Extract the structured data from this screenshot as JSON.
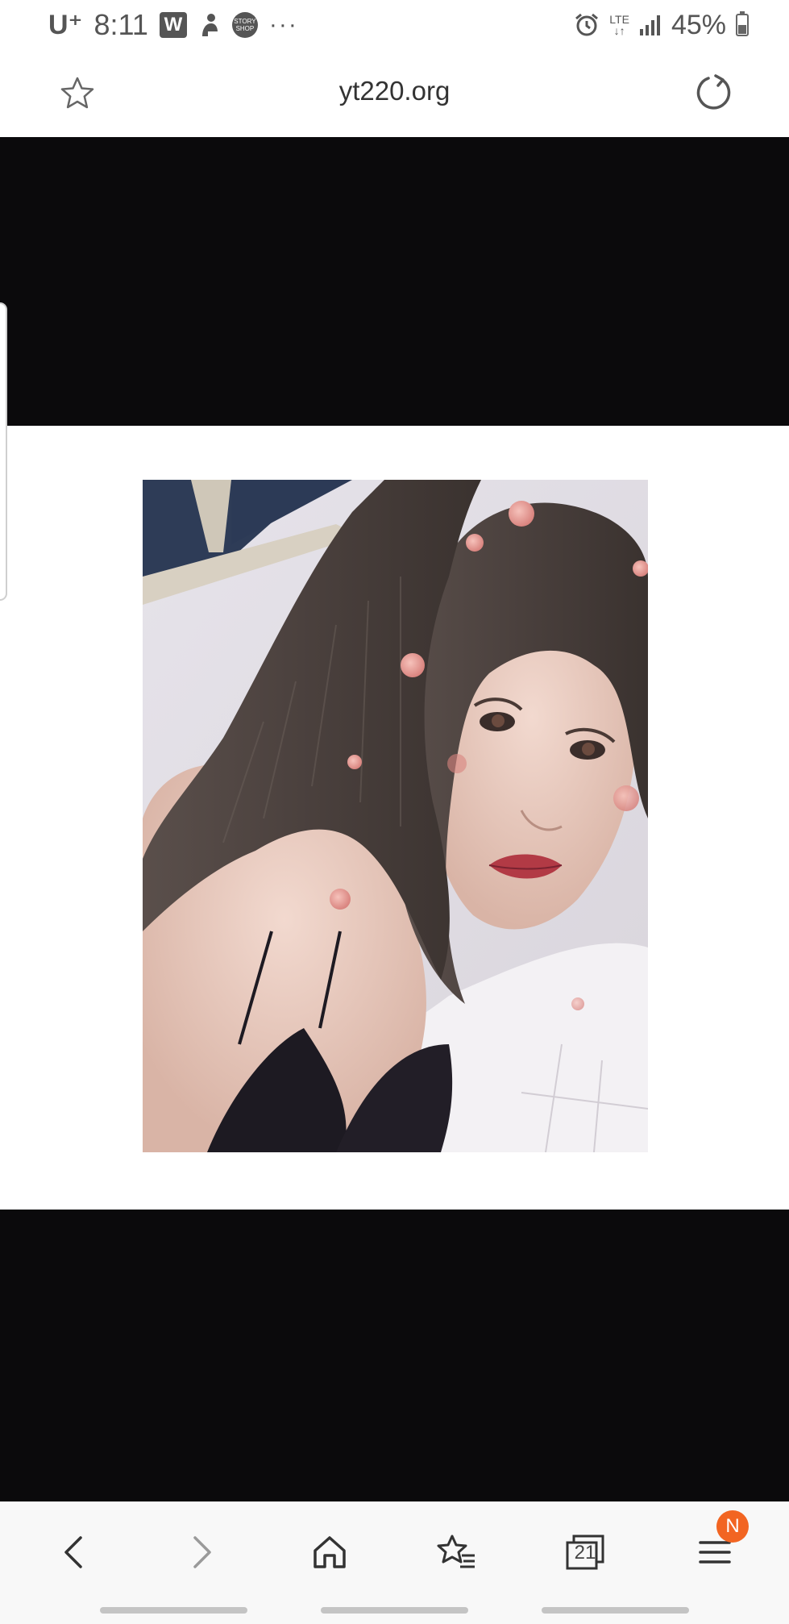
{
  "status_bar": {
    "carrier": "U⁺",
    "time": "8:11",
    "app_badge": "W",
    "story_badge": "STORY SHOP",
    "more": "···",
    "network": "LTE",
    "battery_percent": "45%",
    "battery_level": 0.45
  },
  "browser": {
    "url": "yt220.org",
    "icons": [
      "star-icon",
      "reload-icon"
    ]
  },
  "page": {
    "image": "photo-of-woman-with-long-hair",
    "side_tab": "edge-panel-handle"
  },
  "bottom_nav": {
    "tabs_count": "21",
    "menu_badge": "N",
    "icons": [
      "back-icon",
      "forward-icon",
      "home-icon",
      "bookmarks-icon",
      "tabs-icon",
      "menu-icon"
    ]
  },
  "colors": {
    "badge": "#f26522",
    "page_black": "#0b0a0c",
    "icon": "#555555"
  }
}
